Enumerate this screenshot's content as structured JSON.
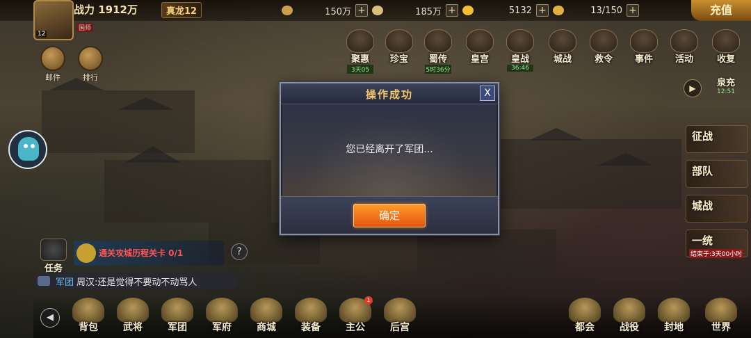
{
  "player": {
    "level_badge": "12",
    "power_label": "战力 1912万",
    "vip_label": "真龙12",
    "nation_tag": "国师"
  },
  "resources": [
    {
      "icon": "wheat-icon",
      "value": "150万",
      "color": "#c9a14a"
    },
    {
      "icon": "silver-icon",
      "value": "185万",
      "color": "#d8c07a"
    },
    {
      "icon": "gold-ingot-icon",
      "value": "5132",
      "color": "#f0c030"
    },
    {
      "icon": "stamina-icon",
      "value": "13/150",
      "color": "#e0b040"
    }
  ],
  "resource_plus": "+",
  "recharge_label": "充值",
  "left_buttons": [
    {
      "name": "mail",
      "label": "邮件"
    },
    {
      "name": "ranking",
      "label": "排行"
    }
  ],
  "top_functions": [
    {
      "label": "聚惠",
      "sub": "3天05"
    },
    {
      "label": "珍宝",
      "sub": ""
    },
    {
      "label": "蜀传",
      "sub": "5时36分"
    },
    {
      "label": "皇宫",
      "sub": ""
    },
    {
      "label": "皇战",
      "sub": "36:46"
    },
    {
      "label": "城战",
      "sub": ""
    },
    {
      "label": "救令",
      "sub": ""
    },
    {
      "label": "事件",
      "sub": ""
    },
    {
      "label": "活动",
      "sub": ""
    },
    {
      "label": "收复",
      "sub": ""
    }
  ],
  "quanqu": {
    "label": "泉充",
    "sub": "12:51"
  },
  "side_buttons": [
    {
      "label": "征战",
      "sub": ""
    },
    {
      "label": "部队",
      "sub": ""
    },
    {
      "label": "城战",
      "sub": ""
    },
    {
      "label": "一统",
      "sub": "结束于:3天00小时"
    }
  ],
  "task": {
    "label": "任务",
    "text": "通关攻城历程关卡 0/1"
  },
  "help_mark": "?",
  "chat": {
    "channel": "军团",
    "message": "周汉:还是觉得不要动不动骂人"
  },
  "bottom_nav": [
    {
      "label": "背包",
      "badge": ""
    },
    {
      "label": "武将",
      "badge": ""
    },
    {
      "label": "军团",
      "badge": ""
    },
    {
      "label": "军府",
      "badge": ""
    },
    {
      "label": "商城",
      "badge": ""
    },
    {
      "label": "装备",
      "badge": ""
    },
    {
      "label": "主公",
      "badge": "1"
    },
    {
      "label": "后宫",
      "badge": ""
    },
    {
      "label": "都会",
      "badge": ""
    },
    {
      "label": "战役",
      "badge": ""
    },
    {
      "label": "封地",
      "badge": ""
    },
    {
      "label": "世界",
      "badge": ""
    }
  ],
  "dialog": {
    "title": "操作成功",
    "close_glyph": "X",
    "message": "您已经离开了军团...",
    "ok_label": "确定"
  }
}
